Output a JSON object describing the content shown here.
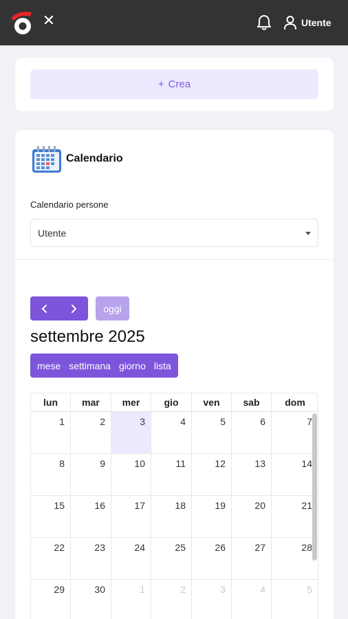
{
  "header": {
    "logo_icon": "app-logo-icon",
    "close_icon": "close-icon",
    "close_glyph": "✕",
    "notifications_icon": "bell-icon",
    "user_icon": "user-icon",
    "user_name": "Utente"
  },
  "create": {
    "label": "Crea",
    "icon_glyph": "+"
  },
  "calendar": {
    "title": "Calendario",
    "icon": "calendar-icon",
    "field_label": "Calendario persone",
    "selected_person": "Utente",
    "nav": {
      "prev_icon": "chevron-left-icon",
      "next_icon": "chevron-right-icon"
    },
    "today_label": "oggi",
    "month_title": "settembre 2025",
    "views": [
      "mese",
      "settimana",
      "giorno",
      "lista"
    ],
    "weekdays": [
      "lun",
      "mar",
      "mer",
      "gio",
      "ven",
      "sab",
      "dom"
    ],
    "days": [
      {
        "n": "1"
      },
      {
        "n": "2"
      },
      {
        "n": "3",
        "today": true
      },
      {
        "n": "4"
      },
      {
        "n": "5"
      },
      {
        "n": "6"
      },
      {
        "n": "7"
      },
      {
        "n": "8"
      },
      {
        "n": "9"
      },
      {
        "n": "10"
      },
      {
        "n": "11"
      },
      {
        "n": "12"
      },
      {
        "n": "13"
      },
      {
        "n": "14"
      },
      {
        "n": "15"
      },
      {
        "n": "16"
      },
      {
        "n": "17"
      },
      {
        "n": "18"
      },
      {
        "n": "19"
      },
      {
        "n": "20"
      },
      {
        "n": "21"
      },
      {
        "n": "22"
      },
      {
        "n": "23"
      },
      {
        "n": "24"
      },
      {
        "n": "25"
      },
      {
        "n": "26"
      },
      {
        "n": "27"
      },
      {
        "n": "28"
      },
      {
        "n": "29"
      },
      {
        "n": "30"
      },
      {
        "n": "1",
        "other": true
      },
      {
        "n": "2",
        "other": true
      },
      {
        "n": "3",
        "other": true
      },
      {
        "n": "4",
        "other": true
      },
      {
        "n": "5",
        "other": true
      }
    ]
  },
  "colors": {
    "accent": "#7c55db",
    "accent_light": "#b7a3ec",
    "today_bg": "#ede9fe",
    "topbar": "#333333",
    "logo_red": "#e3262a"
  }
}
